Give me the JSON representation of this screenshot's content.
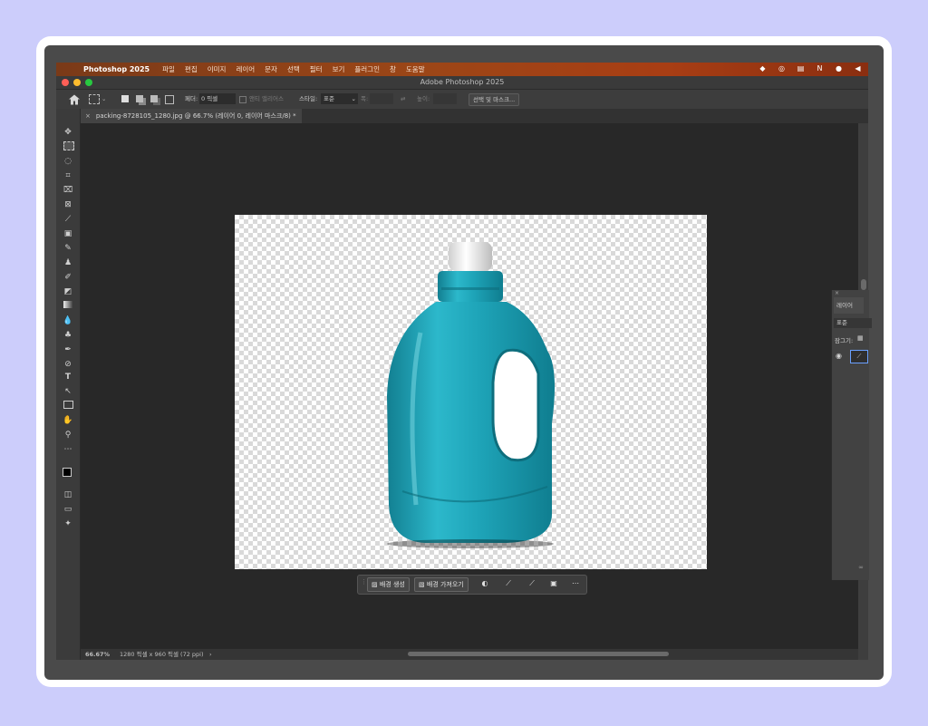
{
  "menubar": {
    "app_name": "Photoshop 2025",
    "items": [
      "파일",
      "편집",
      "이미지",
      "레이어",
      "문자",
      "선택",
      "필터",
      "보기",
      "플러그인",
      "창",
      "도움말"
    ]
  },
  "window": {
    "title": "Adobe Photoshop 2025"
  },
  "options": {
    "feather_label": "페더:",
    "feather_value": "0 픽셀",
    "antialias_label": "앤티 앨리어스",
    "style_label": "스타일:",
    "style_value": "표준",
    "width_label": "폭:",
    "height_label": "높이:",
    "select_mask_button": "선택 및 마스크..."
  },
  "document": {
    "tab_title": "packing-8728105_1280.jpg @ 66.7% (레이어 0, 레이어 마스크/8) *"
  },
  "context_bar": {
    "generate_bg": "배경 생성",
    "import_bg": "배경 가져오기"
  },
  "status": {
    "zoom": "66.67%",
    "doc_info": "1280 픽셀 x 960 픽셀 (72 ppi)",
    "arrow": "›"
  },
  "layers_panel": {
    "tab": "레이어",
    "blend_mode": "표준",
    "lock_label": "잠그기:",
    "footer": "∞"
  },
  "colors": {
    "bottle": "#1f9fb3",
    "menubar": "#a44215",
    "canvas_bg": "#282828"
  }
}
